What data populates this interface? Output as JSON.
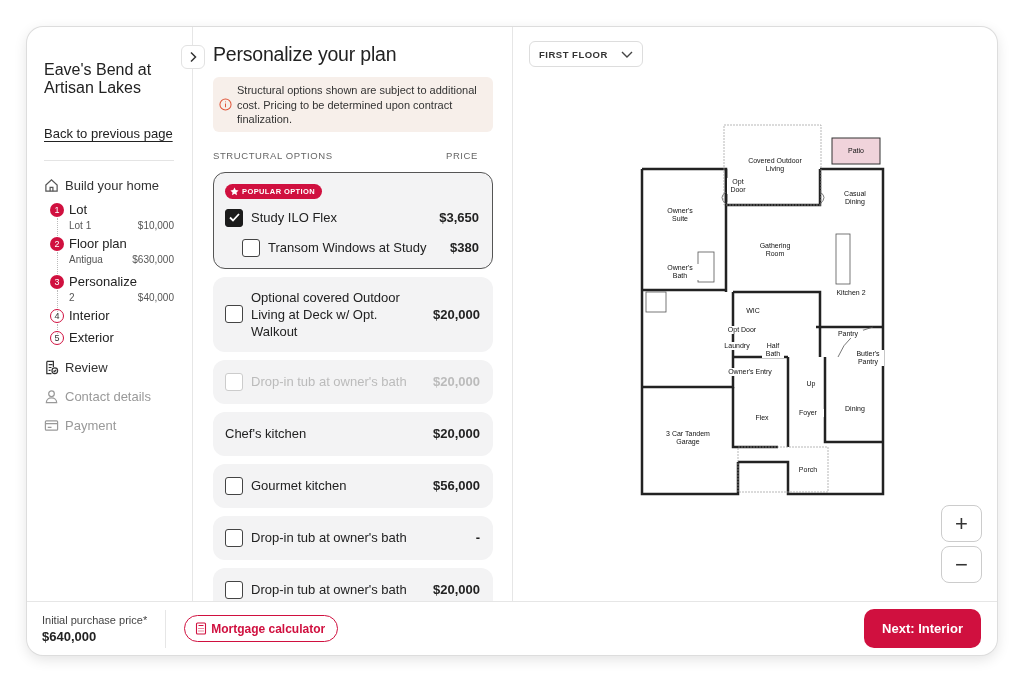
{
  "sidebar": {
    "community": "Eave's Bend at Artisan Lakes",
    "back_link": "Back to previous page",
    "build": {
      "label": "Build your home",
      "steps": [
        {
          "number": "1",
          "label": "Lot",
          "completed": true,
          "detail": "Lot 1",
          "price": "$10,000"
        },
        {
          "number": "2",
          "label": "Floor plan",
          "completed": true,
          "detail": "Antigua",
          "price": "$630,000"
        },
        {
          "number": "3",
          "label": "Personalize",
          "completed": true,
          "detail": "2",
          "price": "$40,000"
        },
        {
          "number": "4",
          "label": "Interior",
          "completed": false
        },
        {
          "number": "5",
          "label": "Exterior",
          "completed": false
        }
      ]
    },
    "nav": [
      {
        "kind": "review",
        "label": "Review",
        "disabled": false
      },
      {
        "kind": "contact",
        "label": "Contact details",
        "disabled": true
      },
      {
        "kind": "payment",
        "label": "Payment",
        "disabled": true
      }
    ]
  },
  "options_panel": {
    "title": "Personalize your plan",
    "notice": "Structural options shown are subject to additional cost. Pricing to be determined upon contract finalization.",
    "columns": [
      "STRUCTURAL OPTIONS",
      "PRICE"
    ],
    "options": [
      {
        "kind": "group",
        "badge": "POPULAR OPTION",
        "label": "Study ILO Flex",
        "price": "$3,650",
        "checked": true,
        "disabled": false,
        "children": [
          {
            "kind": "checkbox",
            "label": "Transom Windows at Study",
            "price": "$380",
            "checked": false,
            "disabled": false
          }
        ]
      },
      {
        "kind": "checkbox",
        "label": "Optional covered Outdoor Living at Deck w/ Opt. Walkout",
        "price": "$20,000",
        "checked": false,
        "disabled": false
      },
      {
        "kind": "checkbox",
        "label": "Drop-in tub at owner's bath",
        "price": "$20,000",
        "checked": false,
        "disabled": true
      },
      {
        "kind": "plain",
        "label": "Chef's kitchen",
        "price": "$20,000"
      },
      {
        "kind": "checkbox",
        "label": "Gourmet kitchen",
        "price": "$56,000",
        "checked": false,
        "disabled": false
      },
      {
        "kind": "checkbox",
        "label": "Drop-in tub at owner's bath",
        "price": "-",
        "checked": false,
        "disabled": false
      },
      {
        "kind": "checkbox",
        "label": "Drop-in tub at owner's bath",
        "price": "$20,000",
        "checked": false,
        "disabled": false
      }
    ]
  },
  "floor_plan": {
    "floor_select": "FIRST FLOOR",
    "rooms": [
      {
        "label": "Covered Outdoor Living"
      },
      {
        "label": "Patio",
        "highlighted": true
      },
      {
        "label": "Opt Door"
      },
      {
        "label": "Owner's Suite"
      },
      {
        "label": "Casual Dining"
      },
      {
        "label": "Gathering Room"
      },
      {
        "label": "Owner's Bath"
      },
      {
        "label": "Kitchen 2"
      },
      {
        "label": "WIC"
      },
      {
        "label": "Opt Door"
      },
      {
        "label": "Laundry"
      },
      {
        "label": "Half Bath"
      },
      {
        "label": "Pantry"
      },
      {
        "label": "Butler's Pantry"
      },
      {
        "label": "Owner's Entry"
      },
      {
        "label": "Up"
      },
      {
        "label": "Flex"
      },
      {
        "label": "Foyer"
      },
      {
        "label": "Dining"
      },
      {
        "label": "3 Car Tandem Garage"
      },
      {
        "label": "Porch"
      }
    ],
    "zoom_in": "+",
    "zoom_out": "−"
  },
  "footer": {
    "price_label": "Initial purchase price*",
    "price": "$640,000",
    "calculator": "Mortgage calculator",
    "next": "Next: Interior"
  }
}
